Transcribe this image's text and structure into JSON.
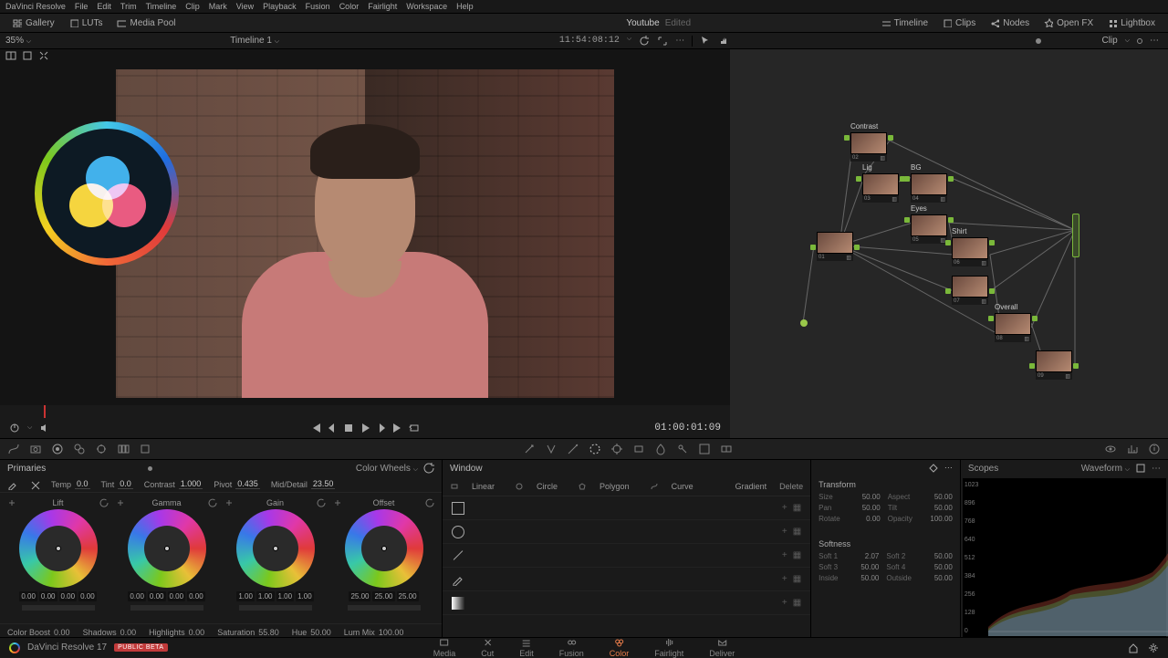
{
  "menu": [
    "DaVinci Resolve",
    "File",
    "Edit",
    "Trim",
    "Timeline",
    "Clip",
    "Mark",
    "View",
    "Playback",
    "Fusion",
    "Color",
    "Fairlight",
    "Workspace",
    "Help"
  ],
  "secbar": {
    "gallery": "Gallery",
    "luts": "LUTs",
    "mediapool": "Media Pool",
    "project": "Youtube",
    "edited": "Edited",
    "timeline_btn": "Timeline",
    "clips_btn": "Clips",
    "nodes_btn": "Nodes",
    "openfx_btn": "Open FX",
    "lightbox_btn": "Lightbox"
  },
  "tlbar": {
    "zoom": "35%",
    "timeline_name": "Timeline 1",
    "tc": "11:54:08:12"
  },
  "nodebar": {
    "mode": "Clip"
  },
  "transport": {
    "tc": "01:00:01:09"
  },
  "nodes": [
    {
      "id": "01",
      "label": "",
      "num": "01"
    },
    {
      "id": "02",
      "label": "Contrast",
      "num": "02"
    },
    {
      "id": "03",
      "label": "Lig",
      "num": "03"
    },
    {
      "id": "04",
      "label": "BG",
      "num": "04"
    },
    {
      "id": "05",
      "label": "Eyes",
      "num": "05"
    },
    {
      "id": "06",
      "label": "Shirt",
      "num": "06"
    },
    {
      "id": "07",
      "label": "",
      "num": "07"
    },
    {
      "id": "08",
      "label": "Overall",
      "num": "08"
    },
    {
      "id": "09",
      "label": "",
      "num": "09"
    }
  ],
  "primaries": {
    "title": "Primaries",
    "mode": "Color Wheels",
    "temp_label": "Temp",
    "temp": "0.0",
    "tint_label": "Tint",
    "tint": "0.0",
    "contrast_label": "Contrast",
    "contrast": "1.000",
    "pivot_label": "Pivot",
    "pivot": "0.435",
    "mid_label": "Mid/Detail",
    "mid": "23.50",
    "wheels": [
      {
        "name": "Lift",
        "vals": [
          "0.00",
          "0.00",
          "0.00",
          "0.00"
        ]
      },
      {
        "name": "Gamma",
        "vals": [
          "0.00",
          "0.00",
          "0.00",
          "0.00"
        ]
      },
      {
        "name": "Gain",
        "vals": [
          "1.00",
          "1.00",
          "1.00",
          "1.00"
        ]
      },
      {
        "name": "Offset",
        "vals": [
          "25.00",
          "25.00",
          "25.00"
        ]
      }
    ],
    "color_boost_label": "Color Boost",
    "color_boost": "0.00",
    "shadows_label": "Shadows",
    "shadows": "0.00",
    "highlights_label": "Highlights",
    "highlights": "0.00",
    "saturation_label": "Saturation",
    "saturation": "55.80",
    "hue_label": "Hue",
    "hue": "50.00",
    "lum_mix_label": "Lum Mix",
    "lum_mix": "100.00"
  },
  "window": {
    "title": "Window",
    "linear": "Linear",
    "circle": "Circle",
    "polygon": "Polygon",
    "curve": "Curve",
    "gradient": "Gradient",
    "delete": "Delete"
  },
  "keyframe": {
    "transform": "Transform",
    "size": "Size",
    "size_v": "50.00",
    "aspect": "Aspect",
    "aspect_v": "50.00",
    "pan": "Pan",
    "pan_v": "50.00",
    "tilt": "Tilt",
    "tilt_v": "50.00",
    "rotate": "Rotate",
    "rotate_v": "0.00",
    "opacity": "Opacity",
    "opacity_v": "100.00",
    "softness": "Softness",
    "soft1": "Soft 1",
    "soft1_v": "2.07",
    "soft2": "Soft 2",
    "soft2_v": "50.00",
    "soft3": "Soft 3",
    "soft3_v": "50.00",
    "soft4": "Soft 4",
    "soft4_v": "50.00",
    "inside": "Inside",
    "inside_v": "50.00",
    "outside": "Outside",
    "outside_v": "50.00"
  },
  "scopes": {
    "title": "Scopes",
    "mode": "Waveform",
    "ticks": [
      "1023",
      "896",
      "768",
      "640",
      "512",
      "384",
      "256",
      "128",
      "0"
    ]
  },
  "pagebar": {
    "app": "DaVinci Resolve 17",
    "badge": "PUBLIC BETA",
    "tabs": [
      "Media",
      "Cut",
      "Edit",
      "Fusion",
      "Color",
      "Fairlight",
      "Deliver"
    ],
    "active": "Color"
  }
}
